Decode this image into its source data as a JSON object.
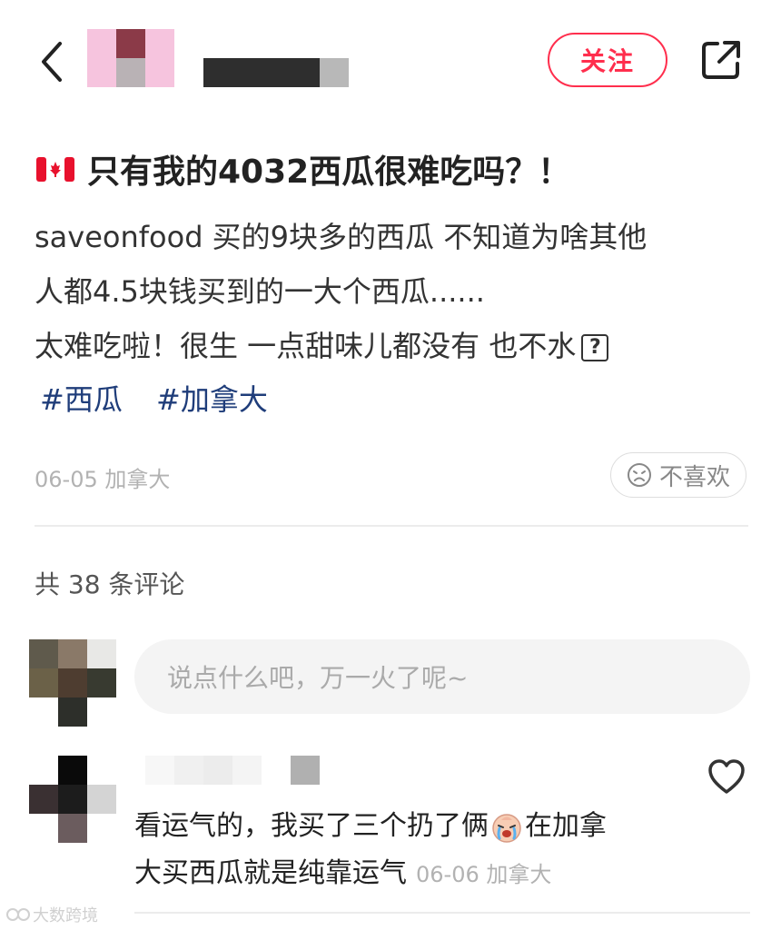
{
  "header": {
    "follow_label": "关注"
  },
  "post": {
    "title": "只有我的4032西瓜很难吃吗？！",
    "body_lines": [
      "saveonfood 买的9块多的西瓜 不知道为啥其他",
      "人都4.5块钱买到的一大个西瓜......",
      "太难吃啦！很生 一点甜味儿都没有 也不水"
    ],
    "tags": [
      "#西瓜",
      "#加拿大"
    ],
    "meta": "06-05 加拿大",
    "dislike_label": "不喜欢"
  },
  "comments_section": {
    "count_label": "共 38 条评论",
    "input_placeholder": "说点什么吧，万一火了呢~"
  },
  "comment": {
    "line1_before_emoji": "看运气的，我买了三个扔了俩",
    "line1_after_emoji": "在加拿",
    "line2": "大买西瓜就是纯靠运气",
    "meta": "06-06 加拿大"
  },
  "watermark": "大数跨境",
  "icons": {
    "back": "chevron-left-icon",
    "share": "share-icon",
    "flag": "canada-flag-icon",
    "dislike": "sad-face-icon",
    "like": "heart-icon",
    "emoji": "crying-face-emoji"
  },
  "colors": {
    "accent": "#ff2e4d",
    "tag": "#1f3d7a",
    "muted": "#b2b2b2"
  }
}
